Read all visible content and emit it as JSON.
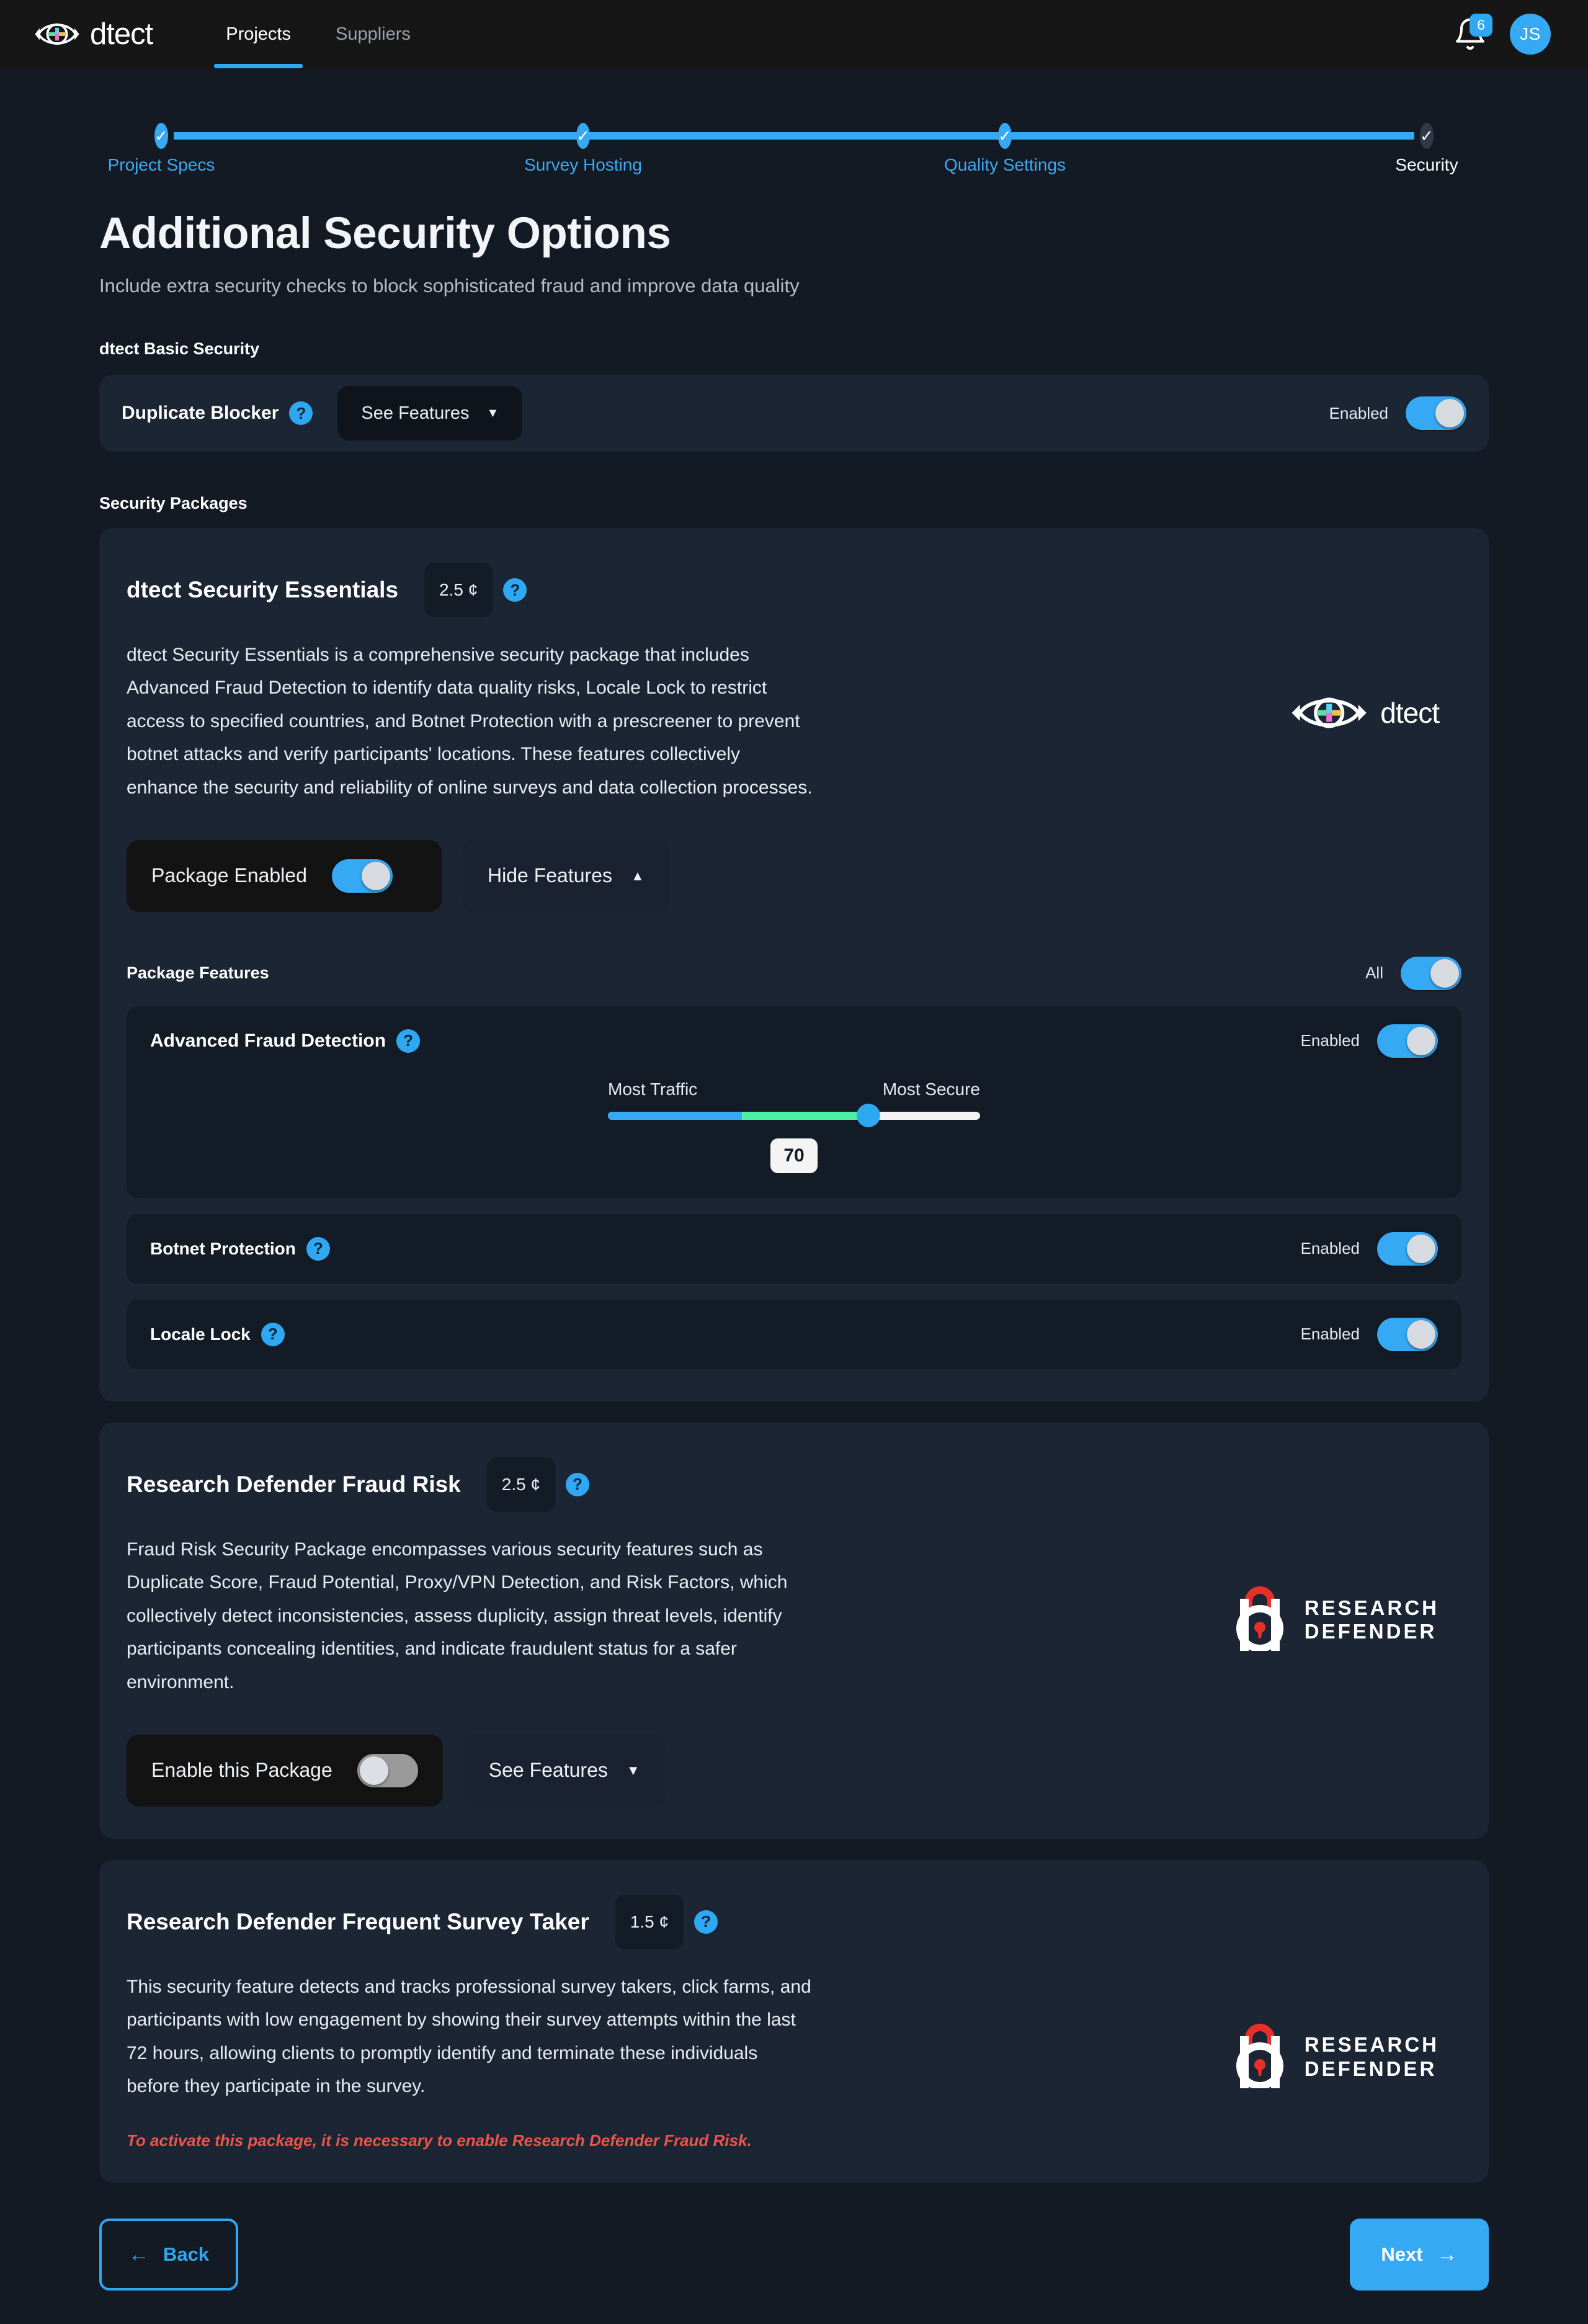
{
  "nav": {
    "brand_word": "dtect",
    "tabs": [
      {
        "label": "Projects",
        "active": true
      },
      {
        "label": "Suppliers",
        "active": false
      }
    ],
    "notifications_count": "6",
    "avatar_initials": "JS"
  },
  "stepper": {
    "steps": [
      {
        "label": "Project Specs",
        "state": "done",
        "check": "✓"
      },
      {
        "label": "Survey Hosting",
        "state": "done",
        "check": "✓"
      },
      {
        "label": "Quality Settings",
        "state": "done",
        "check": "✓"
      },
      {
        "label": "Security",
        "state": "current",
        "check": "✓"
      }
    ]
  },
  "header": {
    "title": "Additional Security Options",
    "subtitle": "Include extra security checks to block sophisticated fraud and improve data quality"
  },
  "basic_security": {
    "section_label": "dtect Basic Security",
    "row": {
      "title": "Duplicate Blocker",
      "help": "?",
      "see_features_label": "See Features",
      "caret": "▼",
      "toggle_label": "Enabled",
      "toggle_on": true
    }
  },
  "packages_section_label": "Security Packages",
  "packages": [
    {
      "title": "dtect Security Essentials",
      "price": "2.5 ¢",
      "help": "?",
      "description": "dtect Security Essentials is a comprehensive security package that includes Advanced Fraud Detection to identify data quality risks, Locale Lock to restrict access to specified countries, and Botnet Protection with a prescreener to prevent botnet attacks and verify participants' locations. These features collectively enhance the security and reliability of online surveys and data collection processes.",
      "logo": "dtect",
      "logo_word": "dtect",
      "enable_label": "Package Enabled",
      "enable_on": true,
      "features_toggle_label": "Hide Features",
      "features_caret": "▲",
      "features_header": "Package Features",
      "all_label": "All",
      "all_on": true,
      "features": [
        {
          "title": "Advanced Fraud Detection",
          "help": "?",
          "toggle_label": "Enabled",
          "toggle_on": true,
          "slider": {
            "left_label": "Most Traffic",
            "right_label": "Most Secure",
            "value": "70",
            "min": 0,
            "max": 100
          }
        },
        {
          "title": "Botnet Protection",
          "help": "?",
          "toggle_label": "Enabled",
          "toggle_on": true
        },
        {
          "title": "Locale Lock",
          "help": "?",
          "toggle_label": "Enabled",
          "toggle_on": true
        }
      ]
    },
    {
      "title": "Research Defender Fraud Risk",
      "price": "2.5 ¢",
      "help": "?",
      "description": "Fraud Risk Security Package encompasses various security features such as Duplicate Score, Fraud Potential, Proxy/VPN Detection, and Risk Factors, which collectively detect inconsistencies, assess duplicity, assign threat levels, identify participants concealing identities, and indicate fraudulent status for a safer environment.",
      "logo": "research-defender",
      "logo_line1": "RESEARCH",
      "logo_line2": "DEFENDER",
      "enable_label": "Enable this Package",
      "enable_on": false,
      "features_toggle_label": "See Features",
      "features_caret": "▼"
    },
    {
      "title": "Research Defender Frequent Survey Taker",
      "price": "1.5 ¢",
      "help": "?",
      "description": "This security feature detects and tracks professional survey takers, click farms, and participants with low engagement by showing their survey attempts within the last 72 hours, allowing clients to promptly identify and terminate these individuals before they participate in the survey.",
      "logo": "research-defender",
      "logo_line1": "RESEARCH",
      "logo_line2": "DEFENDER",
      "warning": "To activate this package, it is necessary to enable Research Defender Fraud Risk."
    }
  ],
  "footer": {
    "back_label": "Back",
    "back_arrow": "←",
    "next_label": "Next",
    "next_arrow": "→"
  },
  "colors": {
    "accent": "#36a9f4",
    "page_bg": "#131a24",
    "card_bg": "#1b2533",
    "nav_bg": "#161616",
    "warning": "#f0534c",
    "slider_green": "#4df0a6"
  }
}
